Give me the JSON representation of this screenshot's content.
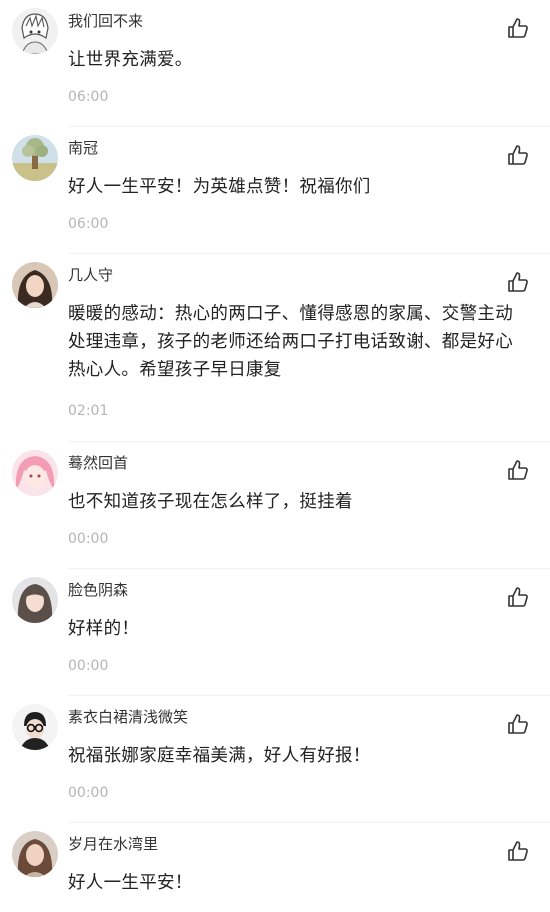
{
  "comments": [
    {
      "username": "我们回不来",
      "content": "让世界充满爱。",
      "time": "06:00",
      "avatar": "anime-sketch-avatar"
    },
    {
      "username": "南冠",
      "content": "好人一生平安！为英雄点赞！祝福你们",
      "time": "06:00",
      "avatar": "tree-landscape-avatar"
    },
    {
      "username": "几人守",
      "content": "暖暖的感动：热心的两口子、懂得感恩的家属、交警主动处理违章，孩子的老师还给两口子打电话致谢、都是好心热心人。希望孩子早日康复",
      "time": "02:01",
      "avatar": "girl-portrait-avatar"
    },
    {
      "username": "蓦然回首",
      "content": "也不知道孩子现在怎么样了，挺挂着",
      "time": "00:00",
      "avatar": "pink-hair-avatar"
    },
    {
      "username": "脸色阴森",
      "content": "好样的！",
      "time": "00:00",
      "avatar": "girl-photo-avatar"
    },
    {
      "username": "素衣白裙清浅微笑",
      "content": "祝福张娜家庭幸福美满，好人有好报！",
      "time": "00:00",
      "avatar": "glasses-man-avatar"
    },
    {
      "username": "岁月在水湾里",
      "content": "好人一生平安！",
      "time": "",
      "avatar": "woman-portrait-avatar"
    }
  ],
  "icons": {
    "like": "thumbs-up-icon"
  },
  "colors": {
    "text": "#222222",
    "username": "#333333",
    "timestamp": "#b5b5b5"
  }
}
